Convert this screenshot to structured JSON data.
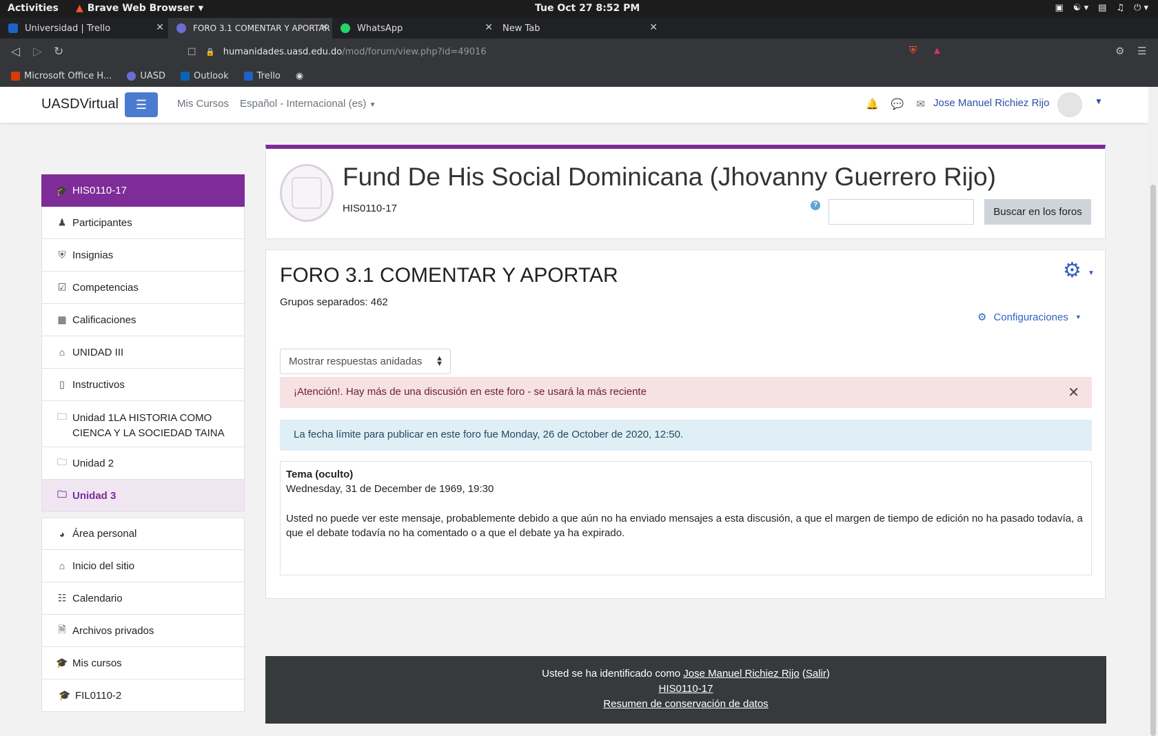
{
  "system": {
    "activities": "Activities",
    "app": "Brave Web Browser",
    "clock": "Tue Oct 27   8:52 PM"
  },
  "tabs": [
    {
      "label": "Universidad | Trello",
      "color": "#1b63c6"
    },
    {
      "label": "FORO 3.1 COMENTAR Y APORTAR",
      "color": "#6b6fd0"
    },
    {
      "label": "WhatsApp",
      "color": "#25d366"
    },
    {
      "label": "New Tab",
      "color": ""
    }
  ],
  "address": {
    "host": "humanidades.uasd.edu.do",
    "path": "/mod/forum/view.php?id=49016"
  },
  "bookmarks": [
    {
      "label": "Microsoft Office H...",
      "color": "#d83b01"
    },
    {
      "label": "UASD",
      "color": "#6b6fd0"
    },
    {
      "label": "Outlook",
      "color": "#0a64b4"
    },
    {
      "label": "Trello",
      "color": "#1b63c6"
    }
  ],
  "navbar": {
    "brand": "UASDVirtual",
    "my_courses": "Mis Cursos",
    "language": "Español - Internacional (es)",
    "user": "Jose Manuel Richiez Rijo"
  },
  "sidebar": {
    "items": [
      {
        "label": "HIS0110-17",
        "icon": "graduation-cap-icon"
      },
      {
        "label": "Participantes",
        "icon": "users-icon"
      },
      {
        "label": "Insignias",
        "icon": "shield-icon"
      },
      {
        "label": "Competencias",
        "icon": "check-square-icon"
      },
      {
        "label": "Calificaciones",
        "icon": "table-icon"
      },
      {
        "label": "UNIDAD III",
        "icon": "home-icon"
      },
      {
        "label": "Instructivos",
        "icon": "book-icon"
      },
      {
        "label": "Unidad 1LA HISTORIA COMO CIENCA Y LA SOCIEDAD TAINA",
        "icon": "folder-icon"
      },
      {
        "label": "Unidad 2",
        "icon": "folder-icon"
      },
      {
        "label": "Unidad 3",
        "icon": "folder-icon"
      },
      {
        "label": "Área personal",
        "icon": "dashboard-icon"
      },
      {
        "label": "Inicio del sitio",
        "icon": "home-icon"
      },
      {
        "label": "Calendario",
        "icon": "calendar-icon"
      },
      {
        "label": "Archivos privados",
        "icon": "file-icon"
      },
      {
        "label": "Mis cursos",
        "icon": "graduation-cap-icon"
      },
      {
        "label": "FIL0110-2",
        "icon": "graduation-cap-icon"
      }
    ]
  },
  "course": {
    "title": "Fund De His Social Dominicana (Jhovanny Guerrero Rijo)",
    "code": "HIS0110-17",
    "search_button": "Buscar en los foros"
  },
  "forum": {
    "title": "FORO 3.1 COMENTAR Y APORTAR",
    "groups": "Grupos separados: 462",
    "settings": "Configuraciones",
    "display_mode": "Mostrar respuestas anidadas",
    "alert": "¡Atención!. Hay más de una discusión en este foro - se usará la más reciente",
    "info": "La fecha límite para publicar en este foro fue Monday, 26 de October de 2020, 12:50.",
    "post_title": "Tema (oculto)",
    "post_date": "Wednesday, 31 de December de 1969, 19:30",
    "post_body": "Usted no puede ver este mensaje, probablemente debido a que aún no ha enviado mensajes a esta discusión, a que el margen de tiempo de edición no ha pasado todavía, a que el debate todavía no ha comentado o a que el debate ya ha expirado."
  },
  "footer": {
    "logged_prefix": "Usted se ha identificado como ",
    "user": "Jose Manuel Richiez Rijo",
    "logout": "Salir",
    "course": "HIS0110-17",
    "data_retention": "Resumen de conservación de datos"
  }
}
